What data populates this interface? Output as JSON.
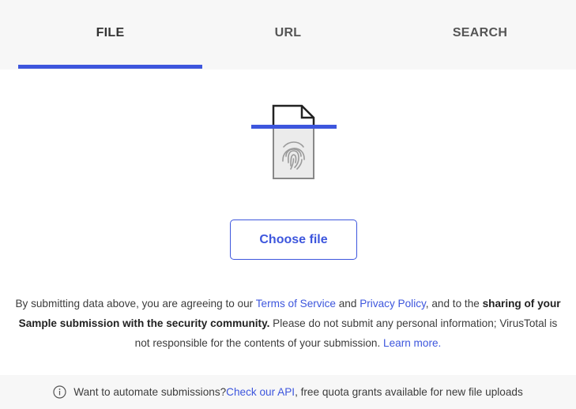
{
  "tabs": [
    {
      "label": "FILE",
      "active": true
    },
    {
      "label": "URL",
      "active": false
    },
    {
      "label": "SEARCH",
      "active": false
    }
  ],
  "upload": {
    "illustration_icon": "fingerprint-file-icon",
    "choose_button_label": "Choose file"
  },
  "legal": {
    "part1": "By submitting data above, you are agreeing to our ",
    "terms_link": "Terms of Service",
    "part2": " and ",
    "privacy_link": "Privacy Policy",
    "part3": ", and to the ",
    "bold_text": "sharing of your Sample submission with the security community.",
    "part4": " Please do not submit any personal information; VirusTotal is not responsible for the contents of your submission. ",
    "learn_more_link": "Learn more."
  },
  "footer": {
    "icon": "info-icon",
    "text_before": "Want to automate submissions? ",
    "api_link": "Check our API",
    "text_after": ", free quota grants available for new file uploads"
  },
  "colors": {
    "accent": "#3d56dd",
    "tab_background": "#f7f7f7",
    "text": "#3c3c3c"
  }
}
